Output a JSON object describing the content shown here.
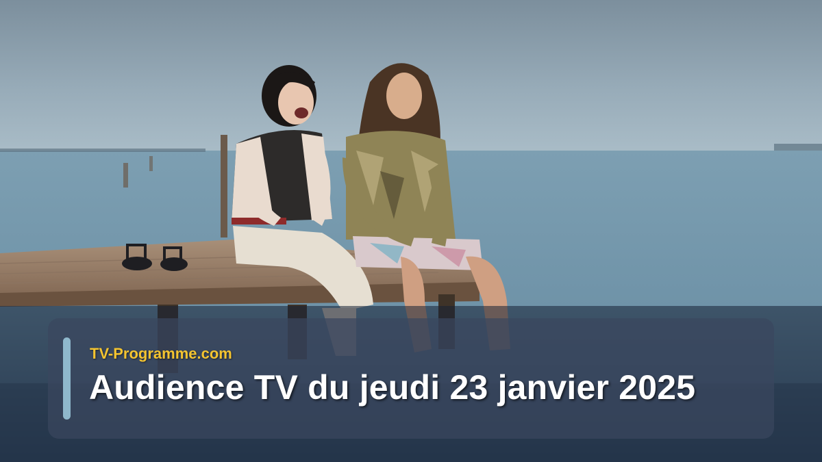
{
  "caption": {
    "site_name": "TV-Programme.com",
    "headline": "Audience TV du jeudi 23 janvier 2025"
  },
  "photo": {
    "description_icon": "photo-couple-on-pier-icon"
  },
  "colors": {
    "site_name": "#f4c430",
    "headline": "#ffffff",
    "accent_bar": "#8fb8cc",
    "sea": "#6f93a8",
    "sky": "#93a8b7"
  }
}
